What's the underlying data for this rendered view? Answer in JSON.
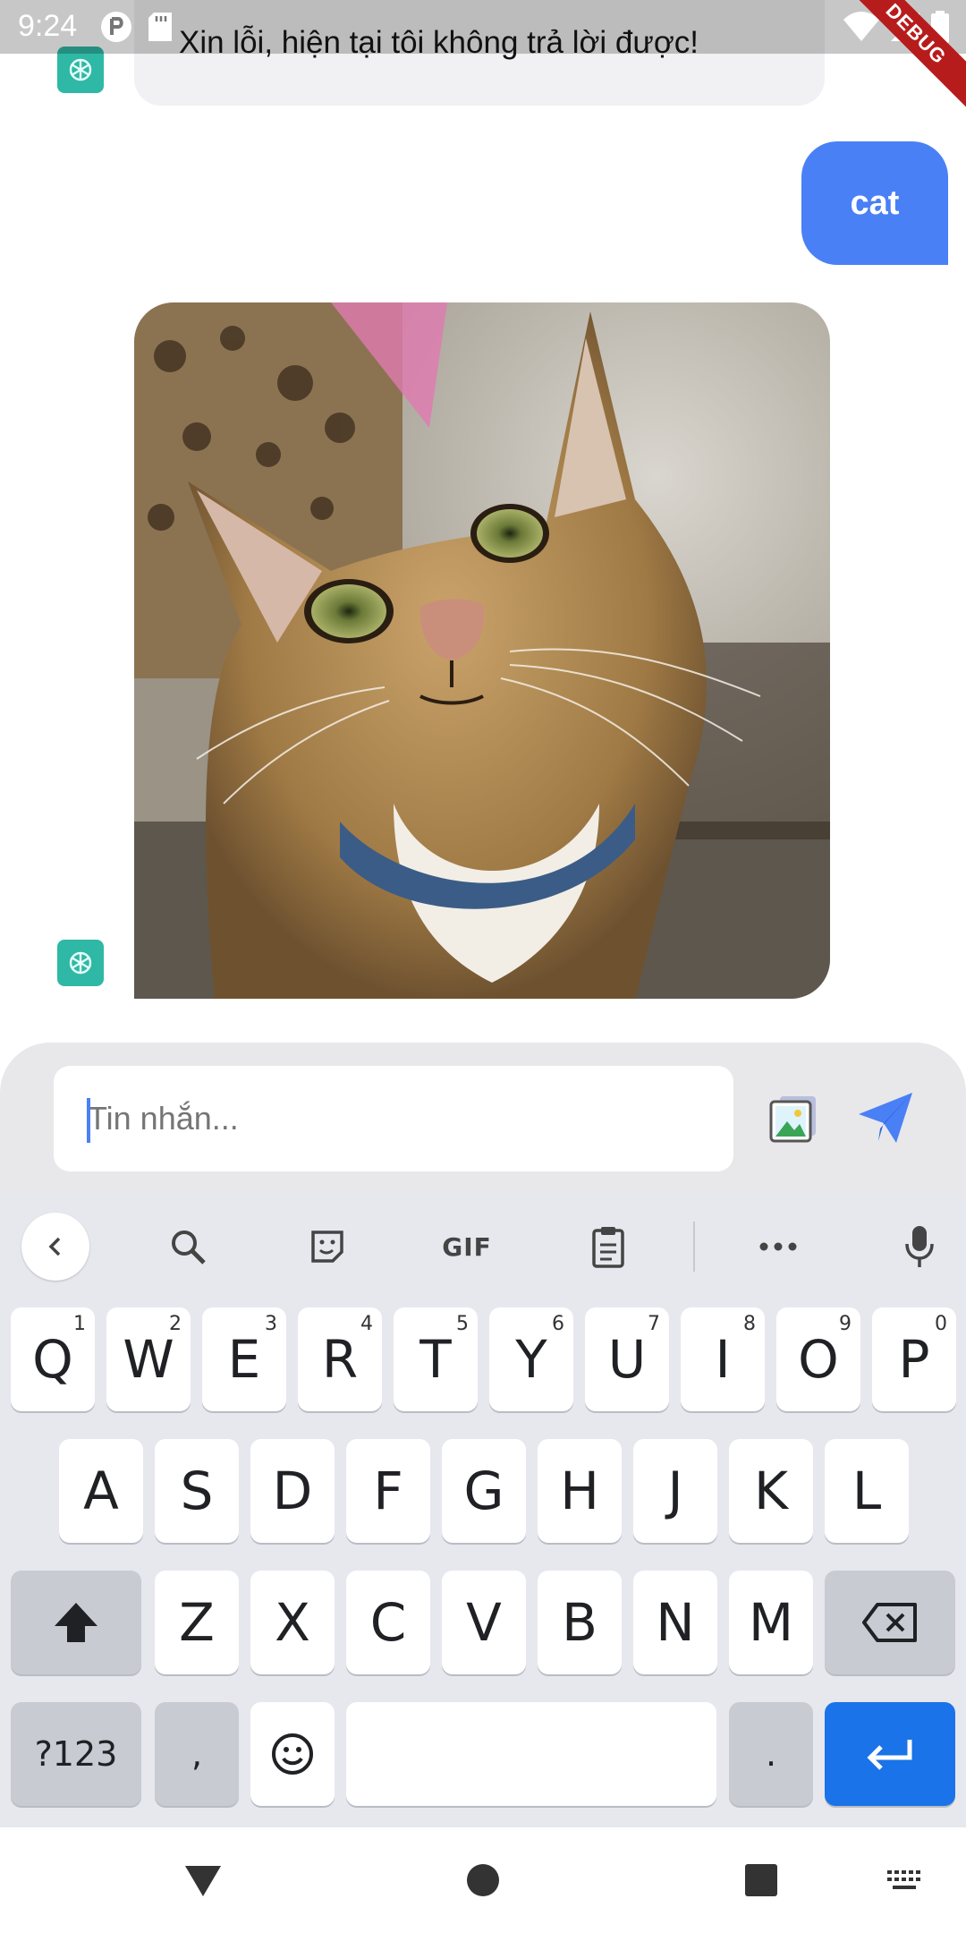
{
  "status_bar": {
    "time": "9:24",
    "debug_label": "DEBUG"
  },
  "chat": {
    "bot_message": "Xin lỗi, hiện tại tôi không trả lời được!",
    "user_message": "cat"
  },
  "composer": {
    "placeholder": "Tin nhắn..."
  },
  "keyboard": {
    "toolbar": {
      "gif_label": "GIF"
    },
    "row1": [
      {
        "label": "Q",
        "hint": "1"
      },
      {
        "label": "W",
        "hint": "2"
      },
      {
        "label": "E",
        "hint": "3"
      },
      {
        "label": "R",
        "hint": "4"
      },
      {
        "label": "T",
        "hint": "5"
      },
      {
        "label": "Y",
        "hint": "6"
      },
      {
        "label": "U",
        "hint": "7"
      },
      {
        "label": "I",
        "hint": "8"
      },
      {
        "label": "O",
        "hint": "9"
      },
      {
        "label": "P",
        "hint": "0"
      }
    ],
    "row2": [
      "A",
      "S",
      "D",
      "F",
      "G",
      "H",
      "J",
      "K",
      "L"
    ],
    "row3": [
      "Z",
      "X",
      "C",
      "V",
      "B",
      "N",
      "M"
    ],
    "symbols_label": "?123",
    "comma_label": ",",
    "period_label": "."
  },
  "colors": {
    "accent": "#4a80f5",
    "enter_key": "#1a73e8",
    "bot_avatar": "#2fb8a5"
  }
}
